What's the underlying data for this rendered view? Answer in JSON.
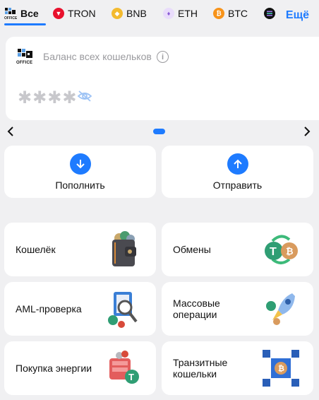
{
  "tabs": [
    {
      "label": "Все",
      "icon": "office-logo-icon",
      "active": true
    },
    {
      "label": "TRON",
      "icon": "tron-icon",
      "color": "#e8112d"
    },
    {
      "label": "BNB",
      "icon": "bnb-icon",
      "color": "#f3ba2f"
    },
    {
      "label": "ETH",
      "icon": "eth-icon",
      "color": "#a97ae8"
    },
    {
      "label": "BTC",
      "icon": "btc-icon",
      "color": "#f7931a"
    },
    {
      "label": "",
      "icon": "sol-icon",
      "color": "#111111"
    }
  ],
  "more_label": "Ещё",
  "balance": {
    "logo_text": "OFFICE",
    "label": "Баланс всех кошельков",
    "info_glyph": "i",
    "hidden_value": "✱✱✱✱"
  },
  "actions": {
    "deposit_label": "Пополнить",
    "send_label": "Отправить"
  },
  "cards": {
    "wallet": "Кошелёк",
    "exchange": "Обмены",
    "aml": "AML-проверка",
    "mass_line1": "Массовые",
    "mass_line2": "операции",
    "energy": "Покупка энергии",
    "transit_line1": "Транзитные",
    "transit_line2": "кошельки"
  },
  "colors": {
    "accent": "#1e7bff",
    "background": "#f0f0f2",
    "muted_text": "#9a9a9e"
  }
}
